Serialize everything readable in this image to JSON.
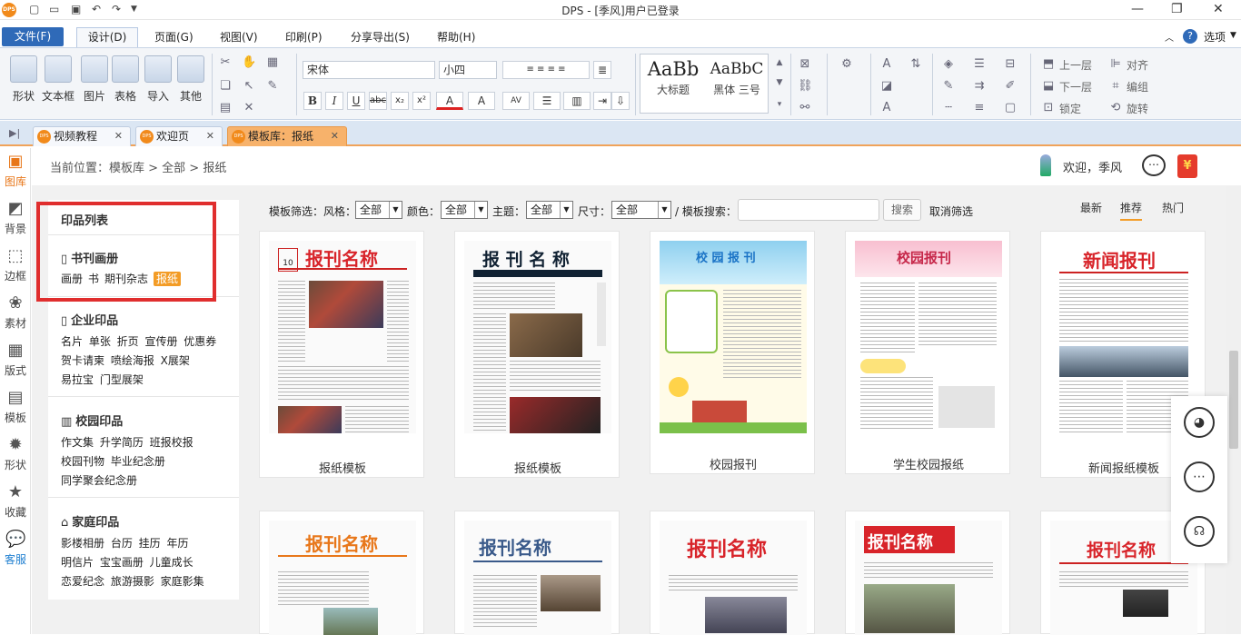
{
  "titlebar": {
    "title": "DPS - [季风]用户已登录",
    "logo": "DPS"
  },
  "menu": {
    "file": "文件(F)",
    "design": "设计(D)",
    "page": "页面(G)",
    "view": "视图(V)",
    "print": "印刷(P)",
    "share": "分享导出(S)",
    "help": "帮助(H)",
    "options": "选项"
  },
  "ribbon": {
    "big_buttons": [
      "形状",
      "文本框",
      "图片",
      "表格",
      "导入",
      "其他"
    ],
    "font_name": "宋体",
    "font_size": "小四",
    "styles": [
      {
        "sample": "AaBb",
        "label": "大标题"
      },
      {
        "sample": "AaBbC",
        "label": "黑体 三号"
      }
    ],
    "arrange": [
      "上一层",
      "下一层",
      "锁定",
      "对齐",
      "编组",
      "旋转"
    ]
  },
  "tabs": [
    {
      "label": "视频教程"
    },
    {
      "label": "欢迎页"
    },
    {
      "label": "模板库：报纸"
    }
  ],
  "sidebar": [
    "图库",
    "背景",
    "边框",
    "素材",
    "版式",
    "模板",
    "形状",
    "收藏",
    "客服"
  ],
  "breadcrumb": "当前位置：模板库 > 全部 > 报纸",
  "welcome": "欢迎，季风",
  "categories": {
    "title": "印品列表",
    "groups": [
      {
        "name": "书刊画册",
        "items": [
          "画册",
          "书",
          "期刊杂志"
        ],
        "active": "报纸"
      },
      {
        "name": "企业印品",
        "rows": [
          "名片 单张 折页 宣传册 优惠券",
          "贺卡请柬 喷绘海报 X展架",
          "易拉宝 门型展架"
        ]
      },
      {
        "name": "校园印品",
        "rows": [
          "作文集 升学简历 班报校报",
          "校园刊物 毕业纪念册",
          "同学聚会纪念册"
        ]
      },
      {
        "name": "家庭印品",
        "rows": [
          "影楼相册 台历 挂历 年历",
          "明信片 宝宝画册 儿童成长",
          "恋爱纪念 旅游摄影 家庭影集"
        ]
      }
    ]
  },
  "filters": {
    "prefix": "模板筛选：风格：",
    "style": "全部",
    "color_label": "颜色：",
    "color": "全部",
    "theme_label": "主题：",
    "theme": "全部",
    "size_label": "尺寸：",
    "size": "全部",
    "search_label": "/ 模板搜索：",
    "search_placeholder": "",
    "search_btn": "搜索",
    "clear": "取消筛选"
  },
  "sort": {
    "newest": "最新",
    "recommend": "推荐",
    "hot": "热门"
  },
  "cards": [
    {
      "caption": "报纸模板",
      "headline": "报刊名称"
    },
    {
      "caption": "报纸模板",
      "headline": "报 刊 名 称"
    },
    {
      "caption": "校园报刊",
      "headline": "校 园 报 刊"
    },
    {
      "caption": "学生校园报纸",
      "headline": "校园报刊"
    },
    {
      "caption": "新闻报纸模板",
      "headline": "新闻报刊"
    },
    {
      "caption": "",
      "headline": "报刊名称"
    },
    {
      "caption": "",
      "headline": "报刊名称"
    },
    {
      "caption": "",
      "headline": "报刊名称"
    },
    {
      "caption": "",
      "headline": "报刊名称"
    },
    {
      "caption": "",
      "headline": "报刊名称"
    }
  ]
}
